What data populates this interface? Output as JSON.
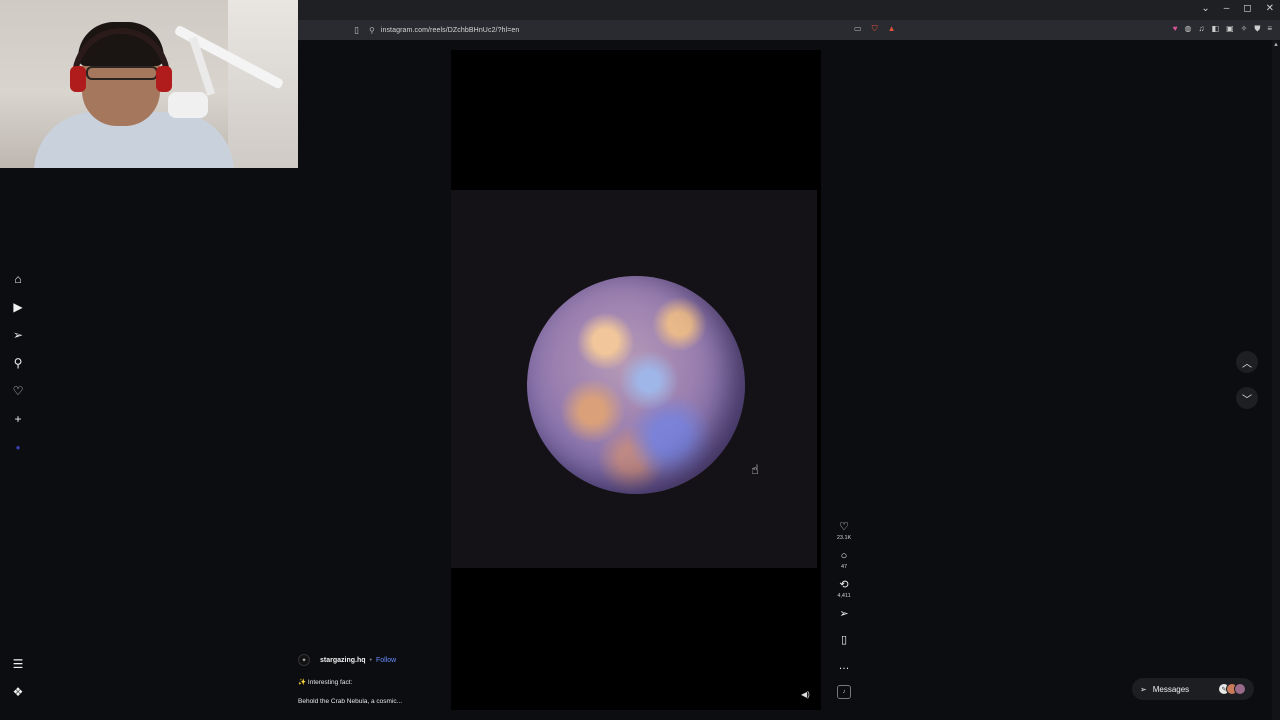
{
  "browser": {
    "url": "instagram.com/reels/DZchbBHnUc2/?hl=en",
    "window_controls": [
      "⌄",
      "–",
      "◻",
      "✕"
    ]
  },
  "reel": {
    "author": "stargazing.hq",
    "separator": "•",
    "follow_label": "Follow",
    "caption_line1": "✨ Interesting fact:",
    "caption_line2": "Behold the Crab Nebula, a cosmic..."
  },
  "actions": {
    "likes": "23.1K",
    "comments": "47",
    "reposts": "4,411"
  },
  "messages": {
    "label": "Messages"
  },
  "icons": {
    "home": "home-icon",
    "reels": "reels-icon",
    "send": "send-icon",
    "search": "search-icon",
    "heart": "heart-icon",
    "create": "plus-icon",
    "menu": "menu-icon",
    "meta": "meta-icon"
  },
  "colors": {
    "follow": "#6b8cff",
    "background": "#0b0d10",
    "brave": "#e0523a"
  }
}
